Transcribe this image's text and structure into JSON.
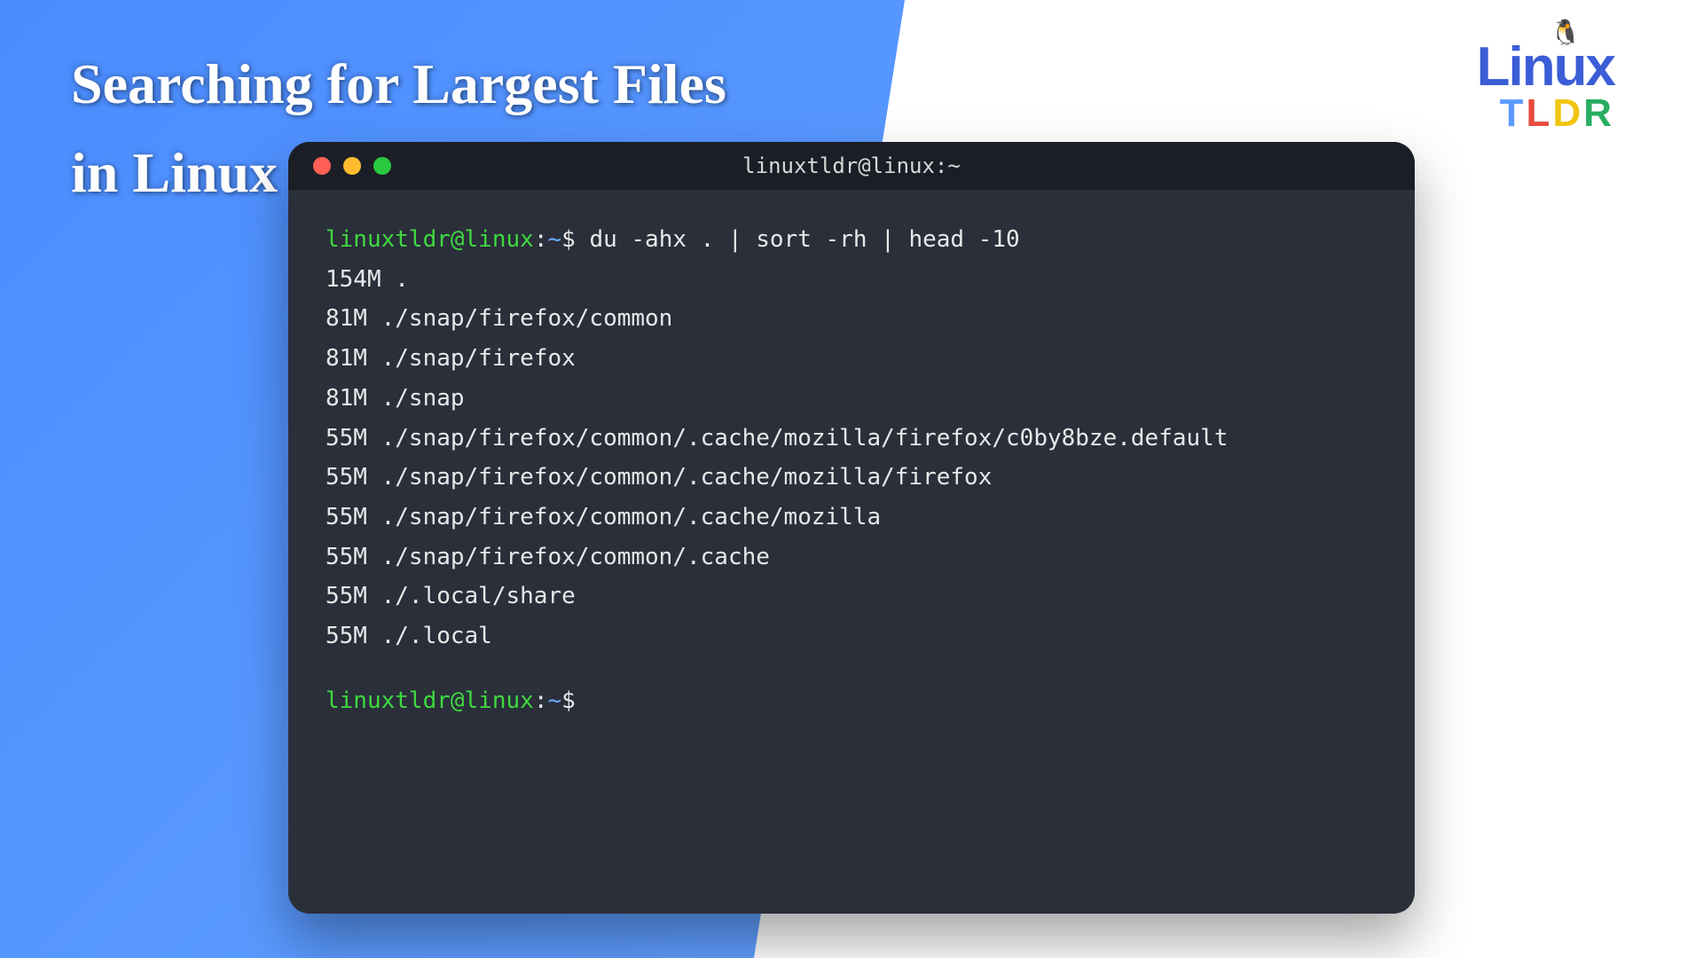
{
  "title": {
    "line1": "Searching for Largest Files",
    "line2": "in Linux"
  },
  "logo": {
    "linux": "Linux",
    "penguin": "🐧",
    "t": "T",
    "l": "L",
    "d": "D",
    "r": "R"
  },
  "terminal": {
    "window_title": "linuxtldr@linux:~",
    "prompt": {
      "user_host": "linuxtldr@linux",
      "colon": ":",
      "path": "~",
      "dollar": "$"
    },
    "command": "du -ahx . | sort -rh | head -10",
    "output": [
      "154M .",
      "81M ./snap/firefox/common",
      "81M ./snap/firefox",
      "81M ./snap",
      "55M ./snap/firefox/common/.cache/mozilla/firefox/c0by8bze.default",
      "55M ./snap/firefox/common/.cache/mozilla/firefox",
      "55M ./snap/firefox/common/.cache/mozilla",
      "55M ./snap/firefox/common/.cache",
      "55M ./.local/share",
      "55M ./.local"
    ]
  }
}
